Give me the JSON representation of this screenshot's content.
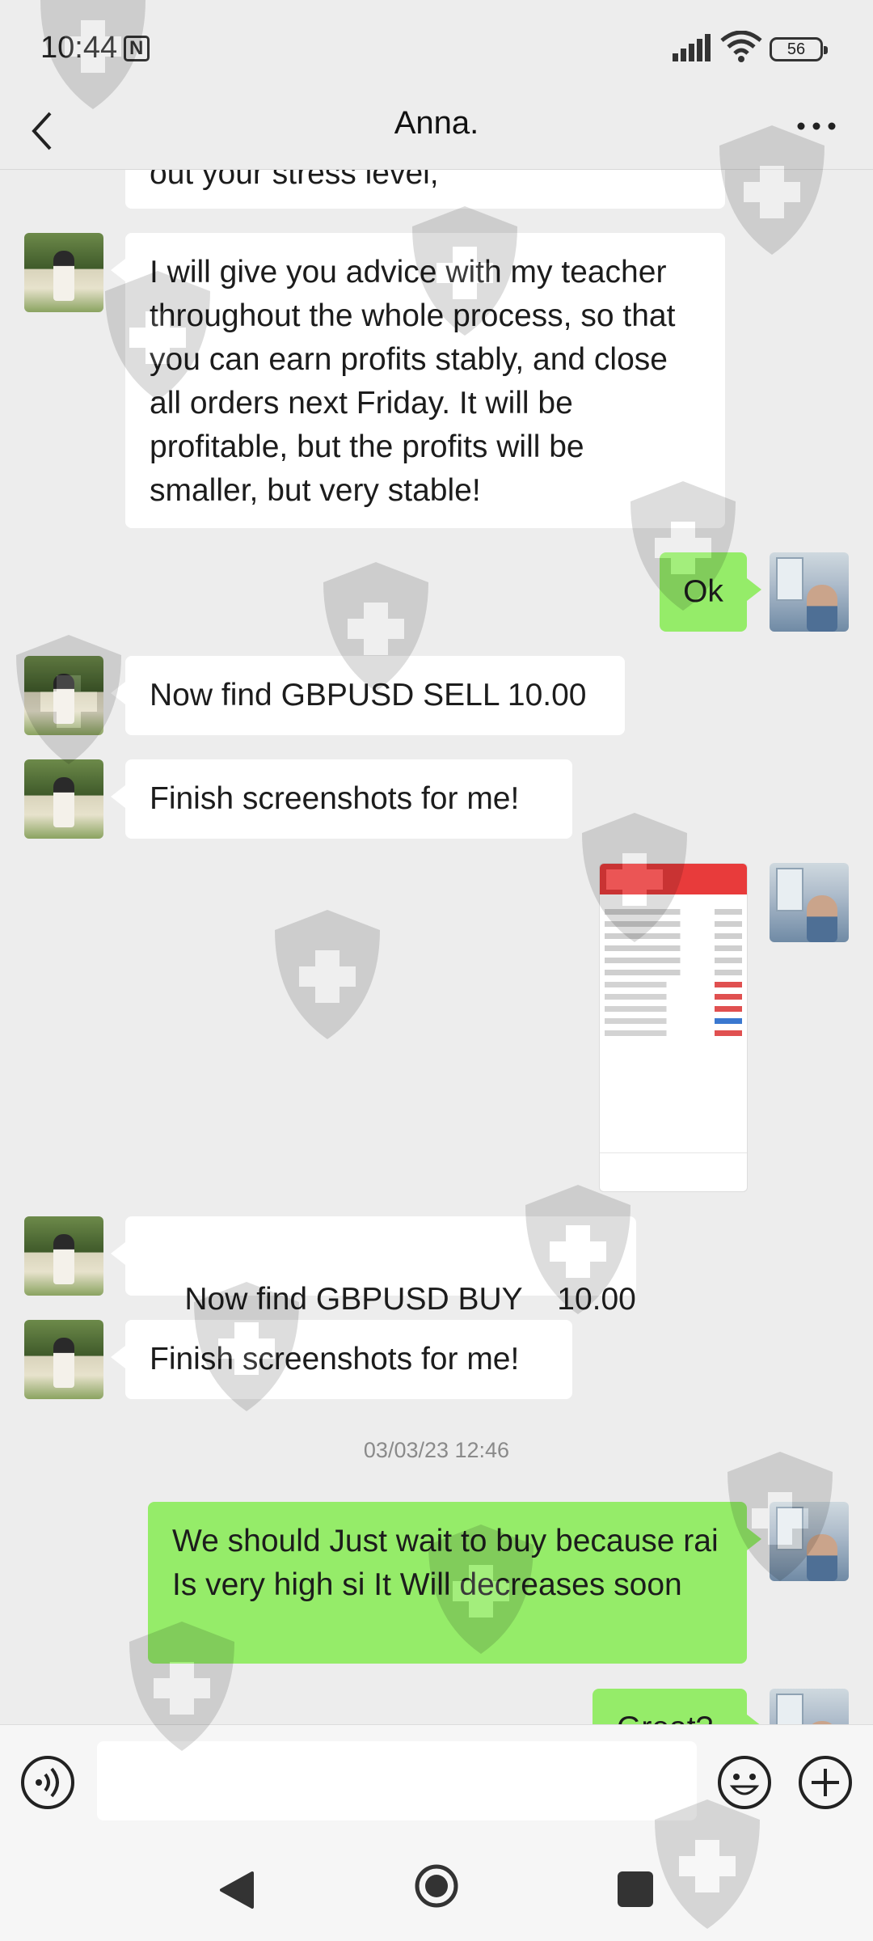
{
  "status_bar": {
    "time": "10:44",
    "battery": "56"
  },
  "header": {
    "title": "Anna."
  },
  "messages": {
    "m1": "out your stress level,",
    "m2": "I will give you advice with my teacher throughout the whole process, so that you can earn profits stably, and close all orders next Friday. It will be profitable, but the profits will be smaller, but very stable!",
    "m3": "Ok",
    "m4": "Now find GBPUSD SELL 10.00",
    "m5": "Finish screenshots for me!",
    "m7": "Now find GBPUSD BUY    10.00",
    "m8": "Finish screenshots for me!",
    "timestamp": "03/03/23 12:46",
    "m9": "We should Just wait to buy because rai Is very high si It Will decreases soon",
    "m10": "Great?"
  },
  "input": {
    "placeholder": ""
  },
  "icons": {
    "back": "chevron-left-icon",
    "more": "more-dots-icon",
    "voice": "voice-icon",
    "emoji": "emoji-icon",
    "plus": "plus-icon",
    "nav_back": "triangle-back-icon",
    "nav_home": "circle-home-icon",
    "nav_recent": "square-recent-icon"
  },
  "colors": {
    "background": "#ededed",
    "outgoing_bubble": "#95ec69",
    "incoming_bubble": "#ffffff"
  }
}
